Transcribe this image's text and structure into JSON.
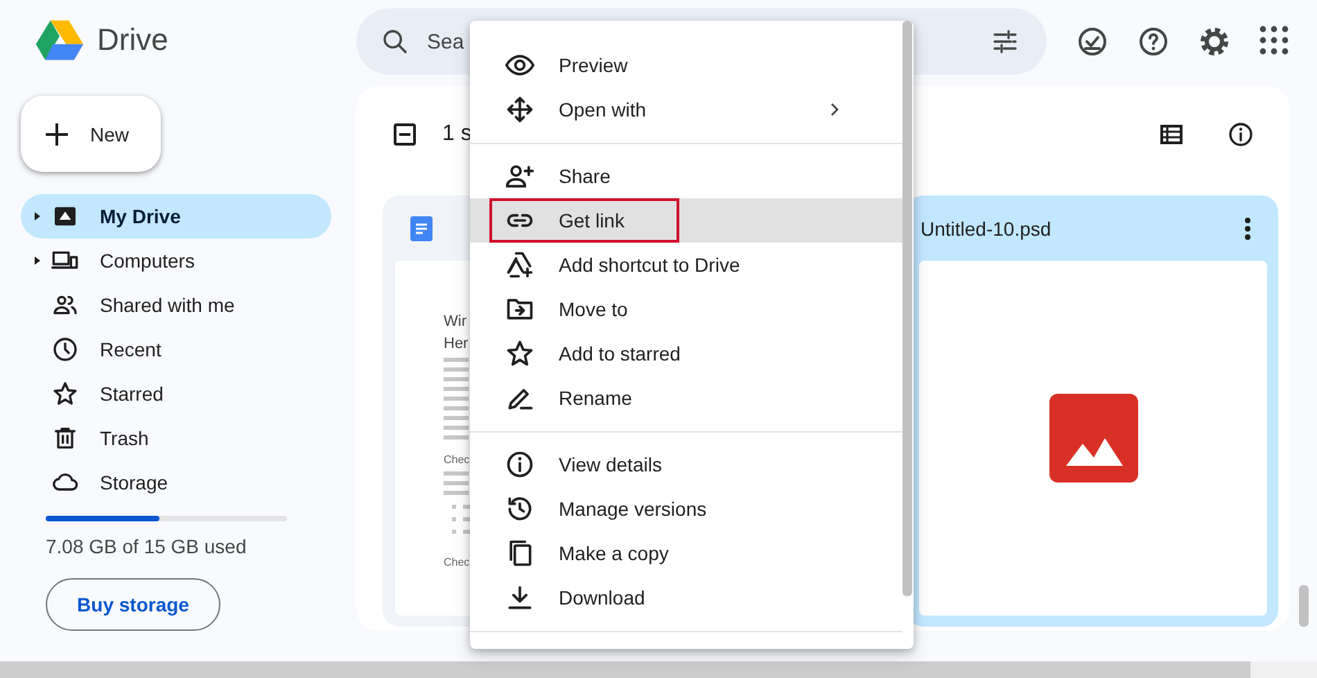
{
  "app": {
    "name": "Drive"
  },
  "new_button": {
    "label": "New"
  },
  "sidebar": {
    "items": [
      {
        "label": "My Drive",
        "expandable": true,
        "selected": true
      },
      {
        "label": "Computers",
        "expandable": true,
        "selected": false
      },
      {
        "label": "Shared with me",
        "expandable": false,
        "selected": false
      },
      {
        "label": "Recent",
        "expandable": false,
        "selected": false
      },
      {
        "label": "Starred",
        "expandable": false,
        "selected": false
      },
      {
        "label": "Trash",
        "expandable": false,
        "selected": false
      },
      {
        "label": "Storage",
        "expandable": false,
        "selected": false
      }
    ]
  },
  "storage": {
    "level": 0.47,
    "usage": "7.08 GB of 15 GB used",
    "button": "Buy storage"
  },
  "search": {
    "placeholder": "Sea"
  },
  "toolbar": {
    "selection": "1 s"
  },
  "files": [
    {
      "kind": "document",
      "selected": false,
      "preview": [
        {
          "kind": "title",
          "text": "Wir"
        },
        {
          "kind": "title",
          "text": "Her"
        },
        {
          "kind": "lines"
        },
        {
          "kind": "lines"
        },
        {
          "kind": "lines"
        },
        {
          "kind": "heading",
          "text": "Chec"
        },
        {
          "kind": "lines"
        },
        {
          "kind": "list"
        },
        {
          "kind": "heading",
          "text": "Chec"
        }
      ]
    },
    {
      "title": "Untitled-10.psd",
      "kind": "image",
      "selected": true
    }
  ],
  "context_menu": {
    "groups": [
      {
        "items": [
          {
            "label": "Preview",
            "submenu": false,
            "selected": false,
            "outlined": false
          },
          {
            "label": "Open with",
            "submenu": true,
            "selected": false,
            "outlined": false
          }
        ]
      },
      {
        "items": [
          {
            "label": "Share",
            "submenu": false,
            "selected": false,
            "outlined": false
          },
          {
            "label": "Get link",
            "submenu": false,
            "selected": true,
            "outlined": true
          },
          {
            "label": "Add shortcut to Drive",
            "submenu": false,
            "selected": false,
            "outlined": false
          },
          {
            "label": "Move to",
            "submenu": false,
            "selected": false,
            "outlined": false
          },
          {
            "label": "Add to starred",
            "submenu": false,
            "selected": false,
            "outlined": false
          },
          {
            "label": "Rename",
            "submenu": false,
            "selected": false,
            "outlined": false
          }
        ]
      },
      {
        "items": [
          {
            "label": "View details",
            "submenu": false,
            "selected": false,
            "outlined": false
          },
          {
            "label": "Manage versions",
            "submenu": false,
            "selected": false,
            "outlined": false
          },
          {
            "label": "Make a copy",
            "submenu": false,
            "selected": false,
            "outlined": false
          },
          {
            "label": "Download",
            "submenu": false,
            "selected": false,
            "outlined": false
          }
        ]
      }
    ]
  }
}
